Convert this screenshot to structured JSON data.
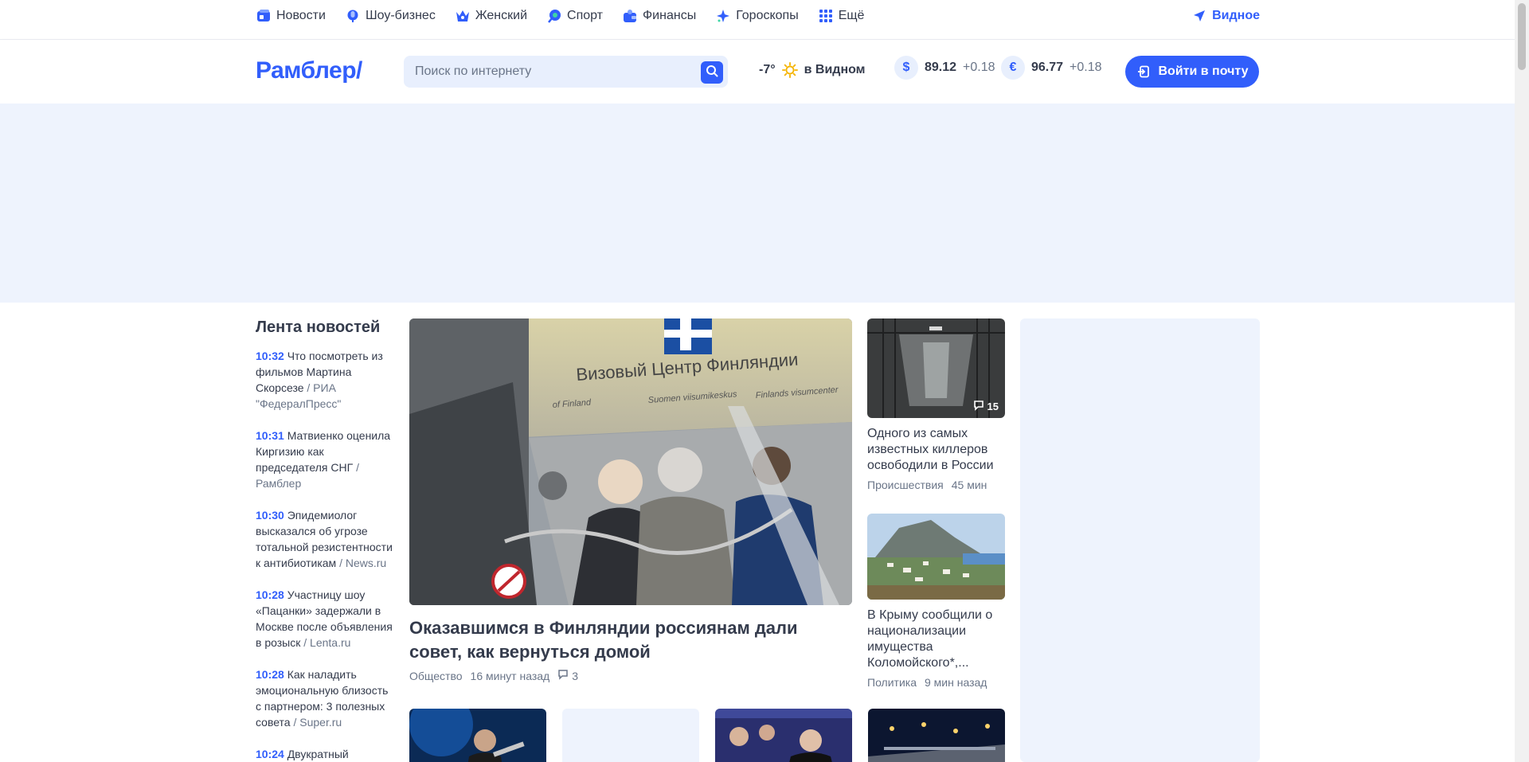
{
  "topnav": {
    "items": [
      {
        "label": "Новости",
        "icon": "news-icon",
        "color": "#315efb"
      },
      {
        "label": "Шоу-бизнес",
        "icon": "mic-icon",
        "color": "#4a7bff"
      },
      {
        "label": "Женский",
        "icon": "crown-icon",
        "color": "#315efb"
      },
      {
        "label": "Спорт",
        "icon": "ball-icon",
        "color": "#315efb"
      },
      {
        "label": "Финансы",
        "icon": "wallet-icon",
        "color": "#315efb"
      },
      {
        "label": "Гороскопы",
        "icon": "star-icon",
        "color": "#315efb"
      },
      {
        "label": "Ещё",
        "icon": "grid-icon",
        "color": "#315efb"
      }
    ],
    "location": "Видное"
  },
  "header": {
    "logo": "Рамблер/",
    "search_placeholder": "Поиск по интернету",
    "weather": {
      "temp": "-7°",
      "city": "в Видном",
      "icon": "sun-icon"
    },
    "currencies": [
      {
        "symbol": "$",
        "value": "89.12",
        "delta": "+0.18"
      },
      {
        "symbol": "€",
        "value": "96.77",
        "delta": "+0.18"
      }
    ],
    "login_label": "Войти в почту"
  },
  "feed": {
    "title": "Лента новостей",
    "entries": [
      {
        "time": "10:32",
        "text": "Что посмотреть из фильмов Мартина Скорсезе",
        "source": "/ РИА \"ФедералПресс\""
      },
      {
        "time": "10:31",
        "text": "Матвиенко оценила Киргизию как председателя СНГ",
        "source": "/ Рамблер"
      },
      {
        "time": "10:30",
        "text": "Эпидемиолог высказался об угрозе тотальной резистентности к антибиотикам",
        "source": "/ News.ru"
      },
      {
        "time": "10:28",
        "text": "Участницу шоу «Пацанки» задержали в Москве после объявления в розыск",
        "source": "/ Lenta.ru"
      },
      {
        "time": "10:28",
        "text": "Как наладить эмоциональную близость с партнером: 3 полезных совета",
        "source": "/ Super.ru"
      },
      {
        "time": "10:24",
        "text": "Двукратный",
        "source": ""
      }
    ]
  },
  "main_story": {
    "image_text": "Визовый Центр Финляндии",
    "image_sub1": "of Finland",
    "image_sub2": "Suomen viisumikeskus",
    "image_sub3": "Finlands visumcenter",
    "title": "Оказавшимся в Финляндии россиянам дали совет, как вернуться домой",
    "category": "Общество",
    "time": "16 минут назад",
    "comments": "3"
  },
  "side_stories": [
    {
      "title": "Одного из самых известных киллеров освободили в России",
      "category": "Происшествия",
      "time": "45 мин",
      "comments": "15"
    },
    {
      "title": "В Крыму сообщили о национализации имущества Коломойского*,...",
      "category": "Политика",
      "time": "9 мин назад",
      "comments": ""
    }
  ]
}
